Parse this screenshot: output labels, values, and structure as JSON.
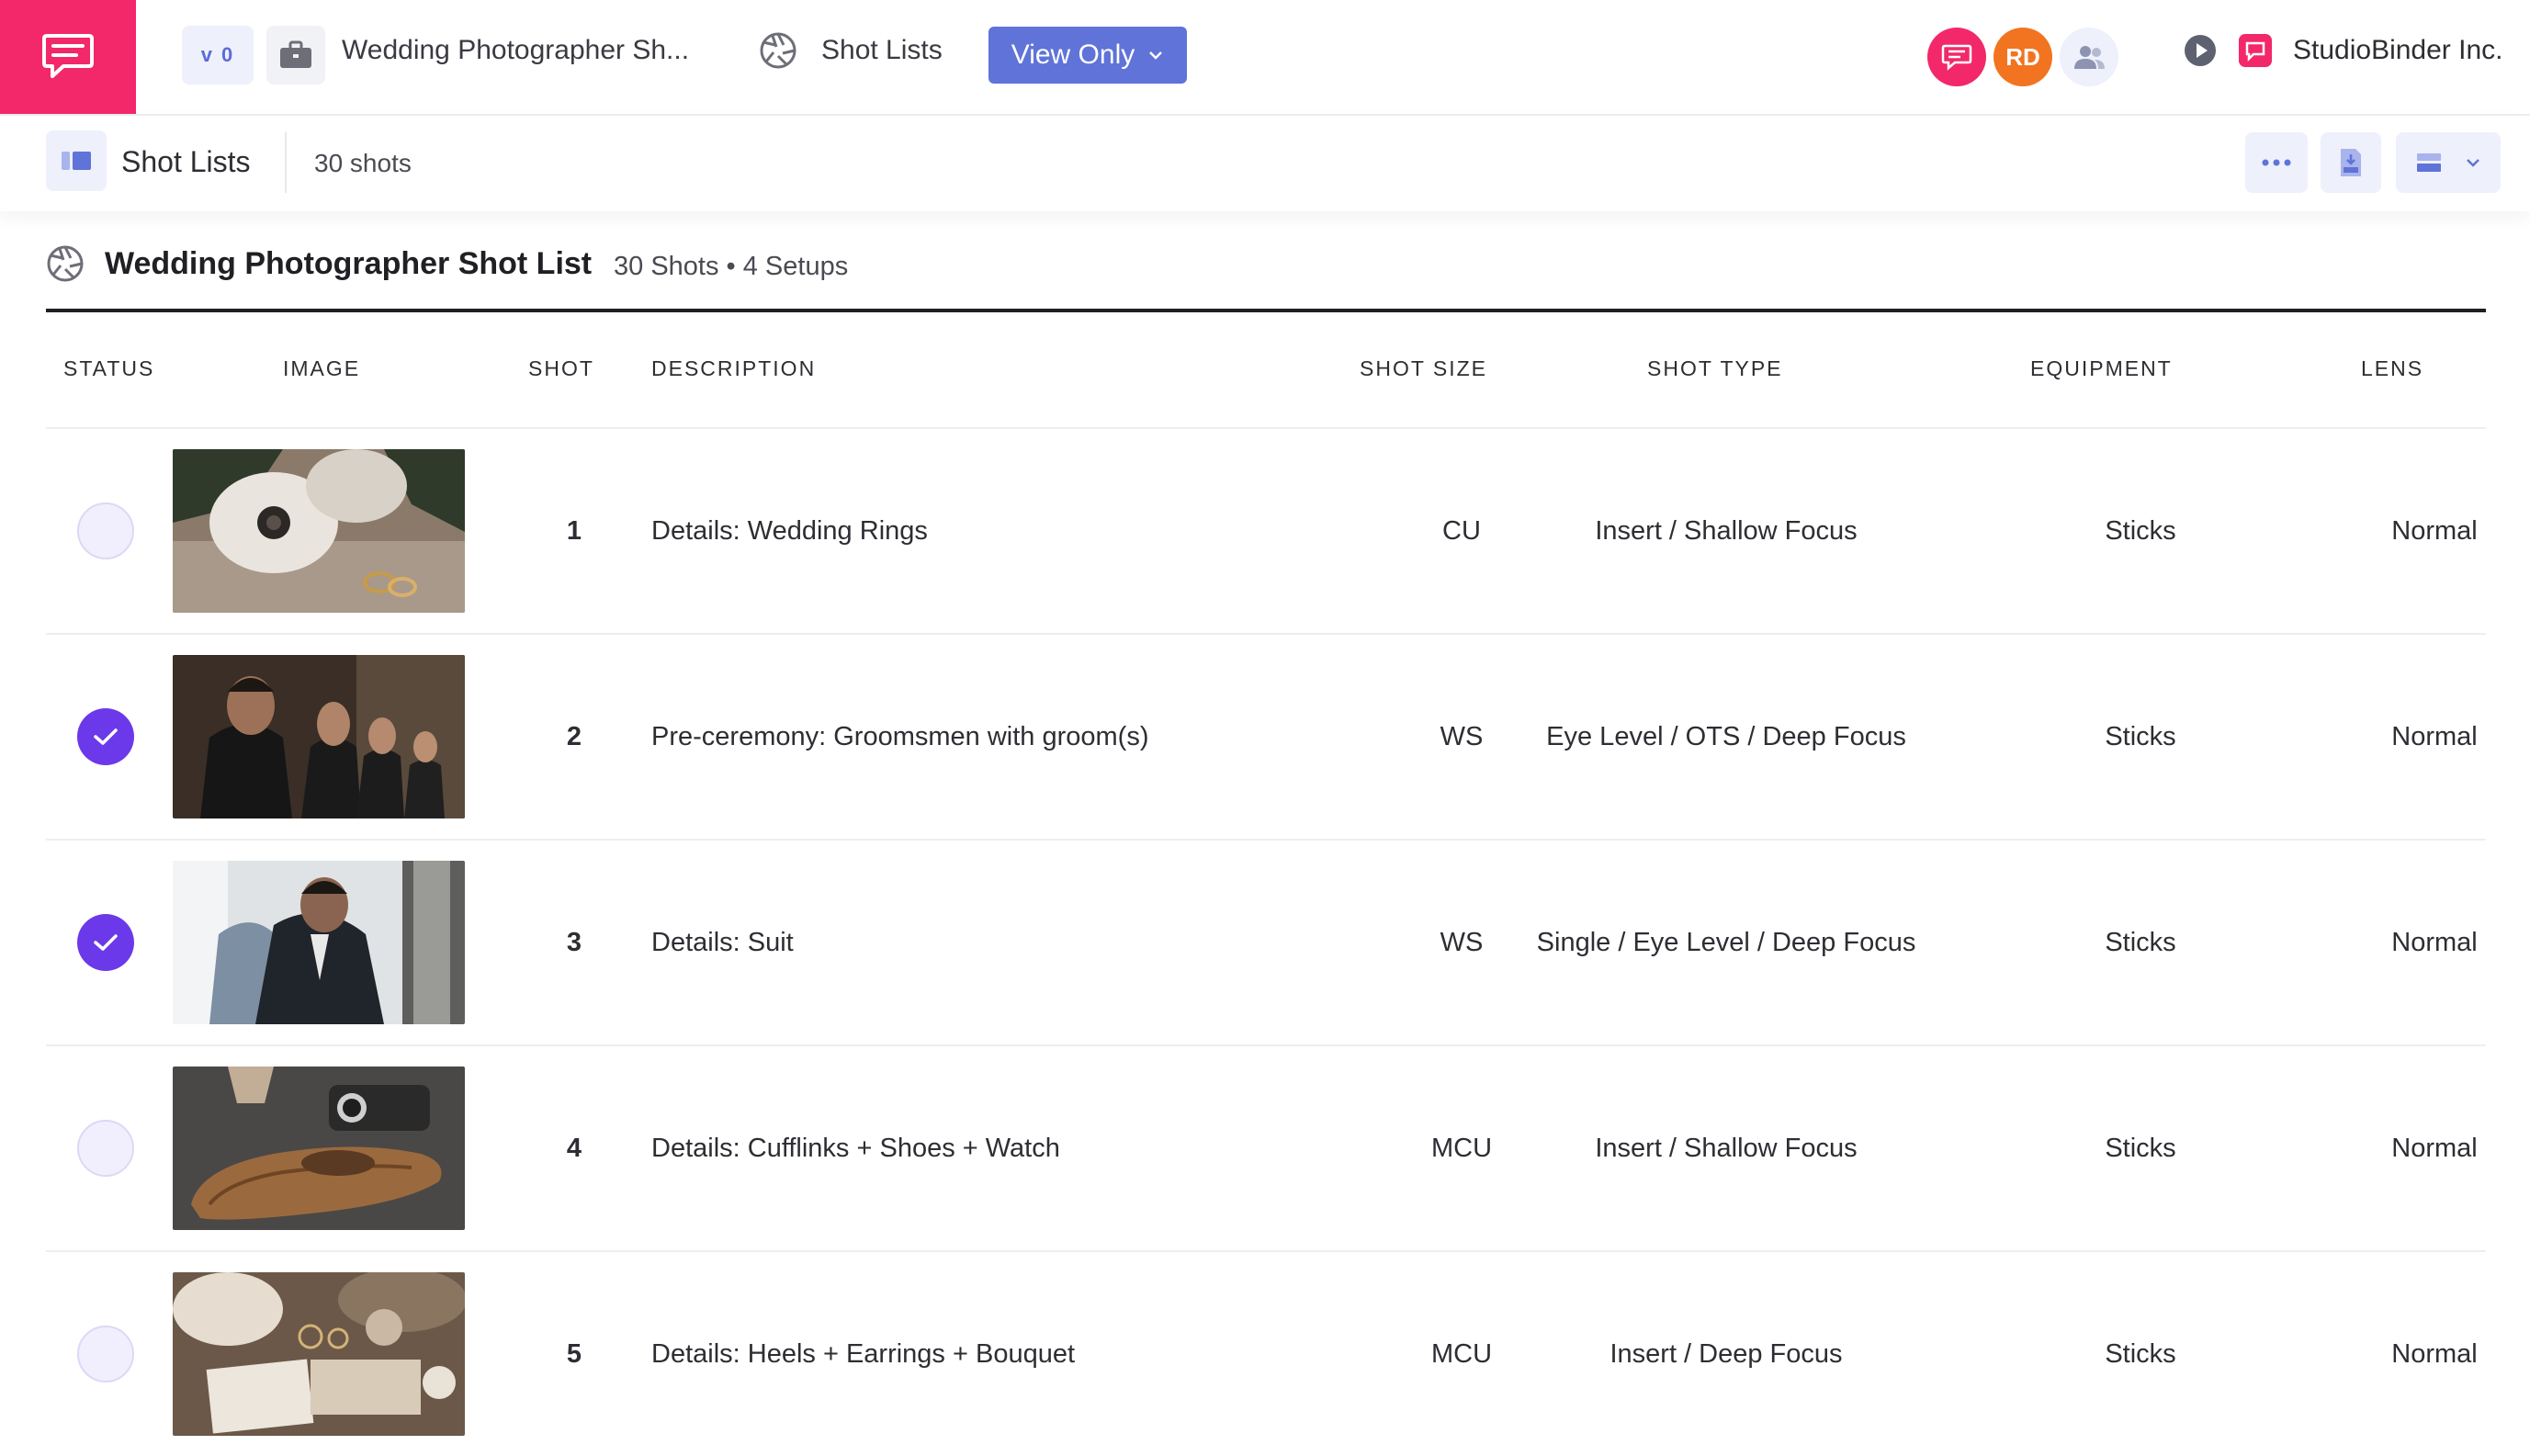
{
  "topbar": {
    "version": "v 0",
    "project_name": "Wedding Photographer Sh...",
    "nav_label": "Shot Lists",
    "view_mode": "View Only",
    "avatars": [
      {
        "initials": "",
        "color": "#f2286b",
        "icon": "chat-icon"
      },
      {
        "initials": "RD",
        "color": "#f27420"
      },
      {
        "initials": "",
        "color": "#eef0fb",
        "icon": "people-icon"
      }
    ],
    "org_name": "StudioBinder Inc."
  },
  "subbar": {
    "title": "Shot Lists",
    "count": "30 shots"
  },
  "list": {
    "title": "Wedding Photographer Shot List",
    "meta": "30 Shots • 4 Setups"
  },
  "columns": {
    "status": "STATUS",
    "image": "IMAGE",
    "shot": "SHOT",
    "description": "DESCRIPTION",
    "shot_size": "SHOT SIZE",
    "shot_type": "SHOT TYPE",
    "equipment": "EQUIPMENT",
    "lens": "LENS"
  },
  "rows": [
    {
      "status": "open",
      "shot": "1",
      "description": "Details: Wedding Rings",
      "shot_size": "CU",
      "shot_type": "Insert / Shallow Focus",
      "equipment": "Sticks",
      "lens": "Normal"
    },
    {
      "status": "done",
      "shot": "2",
      "description": "Pre-ceremony: Groomsmen with groom(s)",
      "shot_size": "WS",
      "shot_type": "Eye Level / OTS / Deep Focus",
      "equipment": "Sticks",
      "lens": "Normal"
    },
    {
      "status": "done",
      "shot": "3",
      "description": "Details: Suit",
      "shot_size": "WS",
      "shot_type": "Single / Eye Level / Deep Focus",
      "equipment": "Sticks",
      "lens": "Normal"
    },
    {
      "status": "open",
      "shot": "4",
      "description": "Details: Cufflinks + Shoes + Watch",
      "shot_size": "MCU",
      "shot_type": "Insert / Shallow Focus",
      "equipment": "Sticks",
      "lens": "Normal"
    },
    {
      "status": "open",
      "shot": "5",
      "description": "Details: Heels + Earrings + Bouquet",
      "shot_size": "MCU",
      "shot_type": "Insert / Deep Focus",
      "equipment": "Sticks",
      "lens": "Normal"
    }
  ],
  "colors": {
    "brand": "#f2286b",
    "accent": "#5f73d8",
    "done": "#6b39e9"
  }
}
